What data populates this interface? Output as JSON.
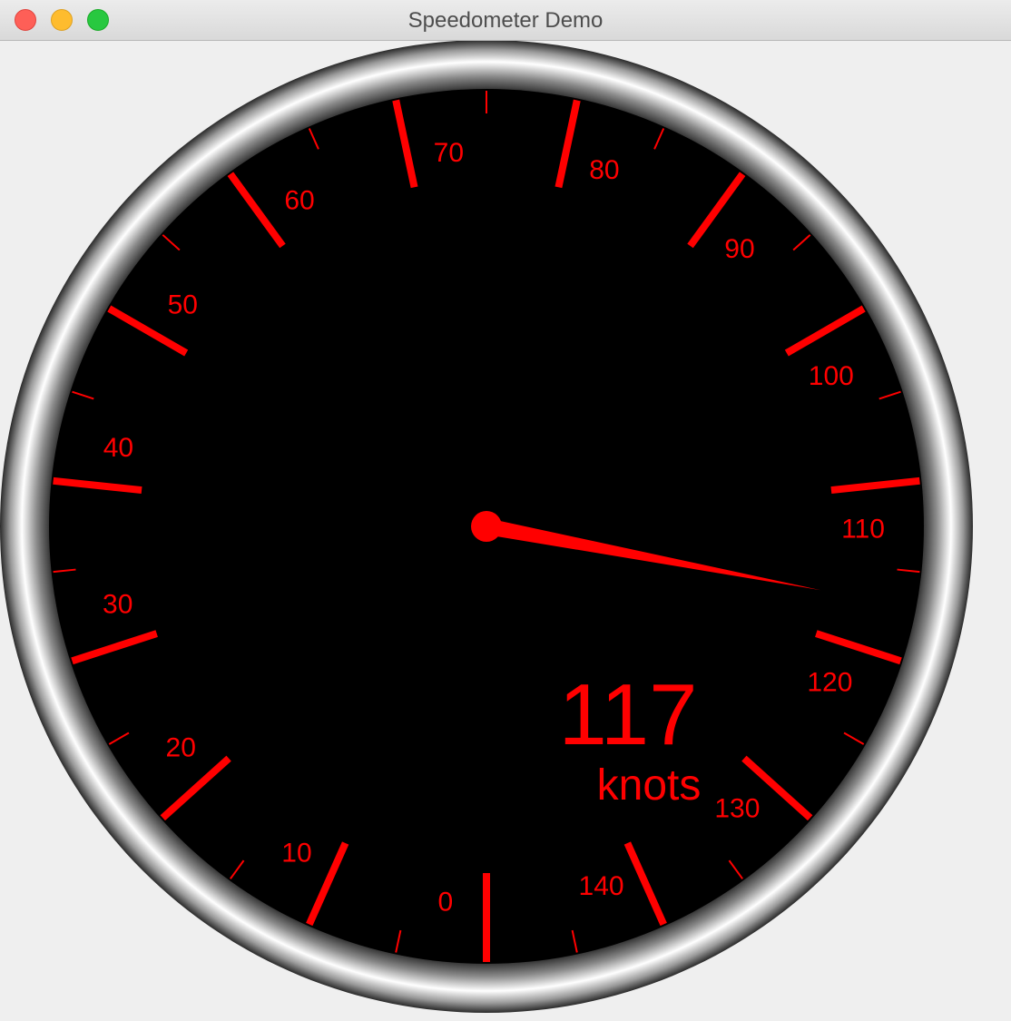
{
  "window": {
    "title": "Speedometer Demo"
  },
  "gauge": {
    "value": 117,
    "value_text": "117",
    "unit": "knots",
    "min": 0,
    "max": 150,
    "major_step": 10,
    "minor_step": 5,
    "tick_labels": [
      "0",
      "10",
      "20",
      "30",
      "40",
      "50",
      "60",
      "70",
      "80",
      "90",
      "100",
      "110",
      "120",
      "130",
      "140"
    ],
    "colors": {
      "needle": "#ff0000",
      "ticks": "#ff0000",
      "face": "#000000",
      "bezel": "#ffffff"
    }
  }
}
